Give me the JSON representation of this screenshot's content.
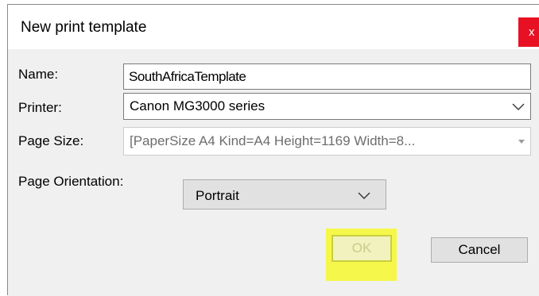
{
  "window": {
    "title": "New print template",
    "close_glyph": "x"
  },
  "form": {
    "name_label": "Name:",
    "name_value": "SouthAfricaTemplate",
    "printer_label": "Printer:",
    "printer_value": "Canon MG3000 series",
    "page_size_label": "Page Size:",
    "page_size_value": "[PaperSize A4 Kind=A4 Height=1169 Width=8...",
    "page_orientation_label": "Page Orientation:",
    "page_orientation_value": "Portrait"
  },
  "buttons": {
    "ok_label": "OK",
    "cancel_label": "Cancel"
  },
  "icons": {
    "printer_dropdown": "chevron-down-icon",
    "page_size_dropdown": "caret-down-icon",
    "orientation_dropdown": "chevron-down-icon"
  },
  "colors": {
    "close_button": "#e81123",
    "highlight": "#f5f74a",
    "dialog_background": "#f0f0f0"
  }
}
